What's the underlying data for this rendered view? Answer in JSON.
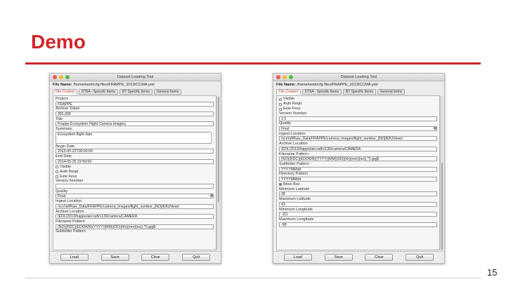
{
  "slide": {
    "title": "Demo",
    "page_number": "15"
  },
  "window": {
    "title": "Dataset Loading Tool",
    "file_label": "File Name:",
    "file_value": "/home/work/cfg files/FRAPPE_2013/CCMA.yml",
    "tabs": [
      "File Content",
      "DT5A - Specific Items",
      "BT Specific Items",
      "General Items"
    ],
    "active_tab_index": 0,
    "buttons": [
      "Load",
      "Save",
      "Clear",
      "Quit"
    ]
  },
  "left_form": {
    "project_label": "Project",
    "project_value": "FRAPPE",
    "archive_token_label": "Archive Token",
    "archive_token_value": "391,008",
    "title_label": "Title",
    "title_value": "Frappe Ecosystem Flight Camera Imagery",
    "summary_label": "Summary",
    "summary_value": "Ecosystem flight data",
    "begin_date_label": "Begin Date",
    "begin_date_value": "2013-05-22T00:00:00",
    "end_date_label": "End Date",
    "end_date_value": "2014-05-25 23:59:59",
    "checks": [
      "Visible",
      "Auth Reqd",
      "Exte Fess"
    ],
    "version_label": "Version Number",
    "version_value": "",
    "quality_label": "Quality",
    "quality_value": "Final",
    "ingest_label": "Ingest Location",
    "ingest_value": "/scr/raf/Raw_Data/FRAPPE/camera_images/flight_number_[NO]/EBJ/down",
    "archive_loc_label": "Archive Location",
    "archive_loc_value": "/EOL/2013/frappe/aircraft/c130/camera/CAMERA",
    "filename_pattern_label": "Filename Pattern",
    "filename_pattern_value": "(NO)(RDC)(EDOWN)(YYYY)(MM)(DD)(hh)(mm)(ss)(.*)\\.jpg$",
    "subfolder_label": "Subfolder Pattern"
  },
  "right_form": {
    "checks": [
      "Visible",
      "Auth Reqd",
      "Exte Fess"
    ],
    "version_label": "Version Number",
    "version_value": "1.0",
    "quality_label": "Quality",
    "quality_value": "Final",
    "ingest_label": "Ingest Location",
    "ingest_value": "/scr/raf/Raw_Data/FRAPPE/camera_images/flight_number_[NO]/EBJ/down",
    "archive_loc_label": "Archive Location",
    "archive_loc_value": "/EOL/2013/frappe/aircraft/c130/camera/CAMERA",
    "filename_pattern_label": "Filename Pattern",
    "filename_pattern_value": "(NO)(RDC)(EDOWN)(YYYY)(MM)(DD)(hh)(mm)(ss)(.*)\\.jpg$",
    "subfolder_label": "Subfolder Pattern",
    "subfolder_value": "YYYYMMdd",
    "directory_label": "Directory Pattern",
    "directory_value": "YYYYMMdd",
    "bbox_check": "Bbox Box",
    "min_lat_label": "Minimum Latitude",
    "min_lat_value": "38",
    "max_lat_label": "Maximum Latitude",
    "max_lat_value": "43",
    "min_lon_label": "Minimum Longitude",
    "min_lon_value": "-111",
    "max_lon_label": "Maximum Longitude",
    "max_lon_value": "-98"
  }
}
